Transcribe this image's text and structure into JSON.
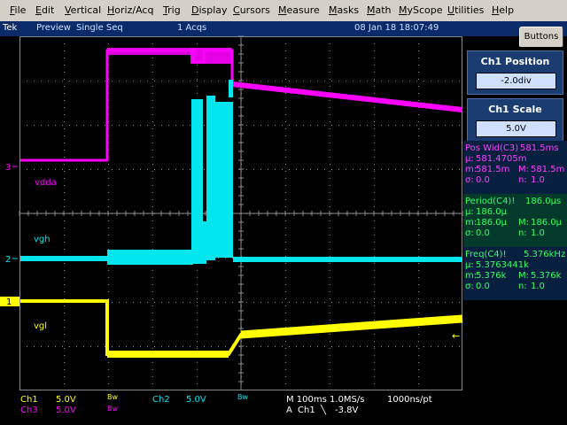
{
  "menu": {
    "items": [
      "File",
      "Edit",
      "Vertical",
      "Horiz/Acq",
      "Trig",
      "Display",
      "Cursors",
      "Measure",
      "Masks",
      "Math",
      "MyScope",
      "Utilities",
      "Help"
    ]
  },
  "status": {
    "brand": "Tek",
    "mode": "Preview",
    "sequence": "Single Seq",
    "acqs": "1 Acqs",
    "datetime": "08 Jan 18 18:07:49",
    "buttons_label": "Buttons"
  },
  "waveforms": {
    "labels": {
      "vdda": "vdda",
      "vgh": "vgh",
      "vgl": "vgl"
    },
    "markers": {
      "ch3": "3",
      "ch2": "2",
      "ch1": "1"
    },
    "colors": {
      "ch1": "#ffff00",
      "ch2": "#00e5ee",
      "ch3": "#ff00ff",
      "grid": "#8a8a8a"
    }
  },
  "right_panel": {
    "position": {
      "title": "Ch1 Position",
      "value": "-2.0div"
    },
    "scale": {
      "title": "Ch1 Scale",
      "value": "5.0V"
    },
    "measurements": [
      {
        "name": "Pos Wid(C3)",
        "value": "581.5ms",
        "mu_label": "μ:",
        "mu": "581.4705m",
        "m_label": "m:",
        "m": "581.5m",
        "M_label": "M:",
        "M": "581.5m",
        "sigma_label": "σ:",
        "sigma": "0.0",
        "n_label": "n:",
        "n": "1.0",
        "color": "#ff40ff"
      },
      {
        "name": "Period(C4)!",
        "value": "186.0μs",
        "mu_label": "μ:",
        "mu": "186.0μ",
        "m_label": "m:",
        "m": "186.0μ",
        "M_label": "M:",
        "M": "186.0μ",
        "sigma_label": "σ:",
        "sigma": "0.0",
        "n_label": "n:",
        "n": "1.0",
        "color": "#33ff66"
      },
      {
        "name": "Freq(C4)!",
        "value": "5.376kHz",
        "mu_label": "μ:",
        "mu": "5.3763441k",
        "m_label": "m:",
        "m": "5.376k",
        "M_label": "M:",
        "M": "5.376k",
        "sigma_label": "σ:",
        "sigma": "0.0",
        "n_label": "n:",
        "n": "1.0",
        "color": "#33ff66"
      }
    ]
  },
  "bottom": {
    "ch1_label": "Ch1",
    "ch1_scale": "5.0V",
    "ch1_bw": "Bw",
    "ch2_label": "Ch2",
    "ch2_scale": "5.0V",
    "ch3_label": "Ch3",
    "ch3_scale": "5.0V",
    "ch3_bw": "Bw",
    "ch2_bw": "Bw",
    "timebase": "M 100ms 1.0MS/s",
    "resolution": "1000ns/pt",
    "trigger_prefix": "A",
    "trigger_channel": "Ch1",
    "trigger_slope": "╲",
    "trigger_level": "-3.8V"
  }
}
